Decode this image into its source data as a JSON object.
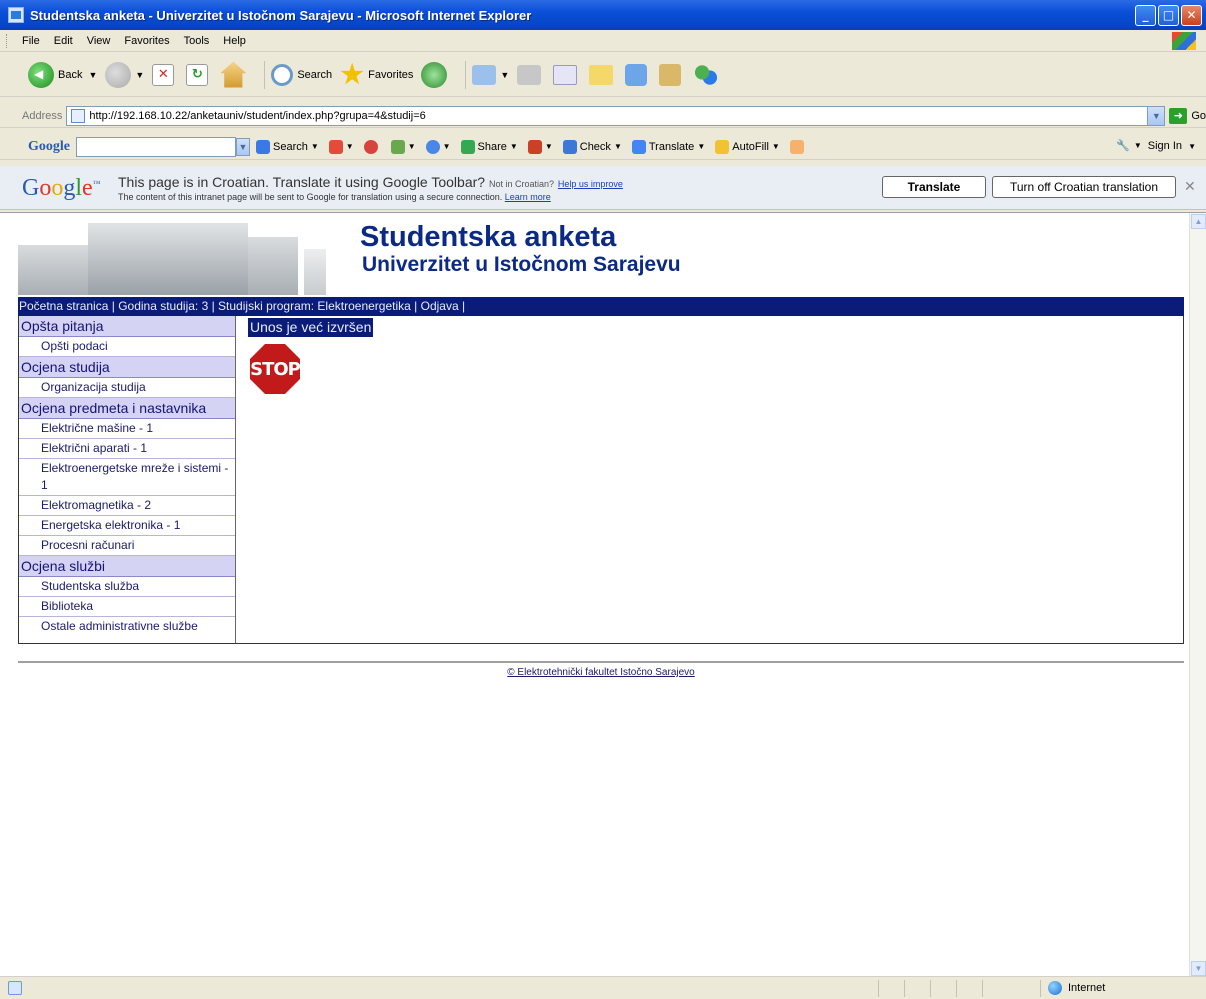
{
  "window": {
    "title": "Studentska anketa - Univerzitet u Istočnom Sarajevu - Microsoft Internet Explorer"
  },
  "menu": [
    "File",
    "Edit",
    "View",
    "Favorites",
    "Tools",
    "Help"
  ],
  "toolbar": {
    "back_label": "Back",
    "search_label": "Search",
    "favorites_label": "Favorites"
  },
  "address": {
    "label": "Address",
    "url": "http://192.168.10.22/anketauniv/student/index.php?grupa=4&studij=6",
    "go_label": "Go"
  },
  "google_toolbar": {
    "logo": "Google",
    "search_label": "Search",
    "share_label": "Share",
    "check_label": "Check",
    "translate_label": "Translate",
    "autofill_label": "AutoFill",
    "signin_label": "Sign In"
  },
  "translate_bar": {
    "message": "This page is in Croatian.  Translate it using Google Toolbar?",
    "not_in": "Not in Croatian?",
    "help_link": "Help us improve",
    "sub": "The content of this intranet page will be sent to Google for translation using a secure connection.",
    "learn_more": "Learn more",
    "translate_button": "Translate",
    "turnoff_button": "Turn off Croatian translation"
  },
  "site": {
    "title": "Studentska anketa",
    "subtitle": "Univerzitet u Istočnom Sarajevu"
  },
  "nav": {
    "home": "Početna stranica",
    "year": "Godina studija: 3",
    "program": "Studijski program: Elektroenergetika",
    "logout": "Odjava"
  },
  "sidebar": {
    "sections": [
      {
        "title": "Opšta pitanja",
        "items": [
          "Opšti podaci"
        ]
      },
      {
        "title": "Ocjena studija",
        "items": [
          "Organizacija studija"
        ]
      },
      {
        "title": "Ocjena predmeta i nastavnika",
        "items": [
          "Električne mašine - 1",
          "Električni aparati - 1",
          "Elektroenergetske mreže i sistemi - 1",
          "Elektromagnetika - 2",
          "Energetska elektronika - 1",
          "Procesni računari"
        ]
      },
      {
        "title": "Ocjena službi",
        "items": [
          "Studentska služba",
          "Biblioteka",
          "Ostale administrativne službe"
        ]
      }
    ]
  },
  "content": {
    "notice": "Unos je već izvršen",
    "stop_text": "STOP"
  },
  "footer": {
    "text": "© Elektrotehnički fakultet Istočno Sarajevo"
  },
  "status": {
    "zone": "Internet"
  }
}
